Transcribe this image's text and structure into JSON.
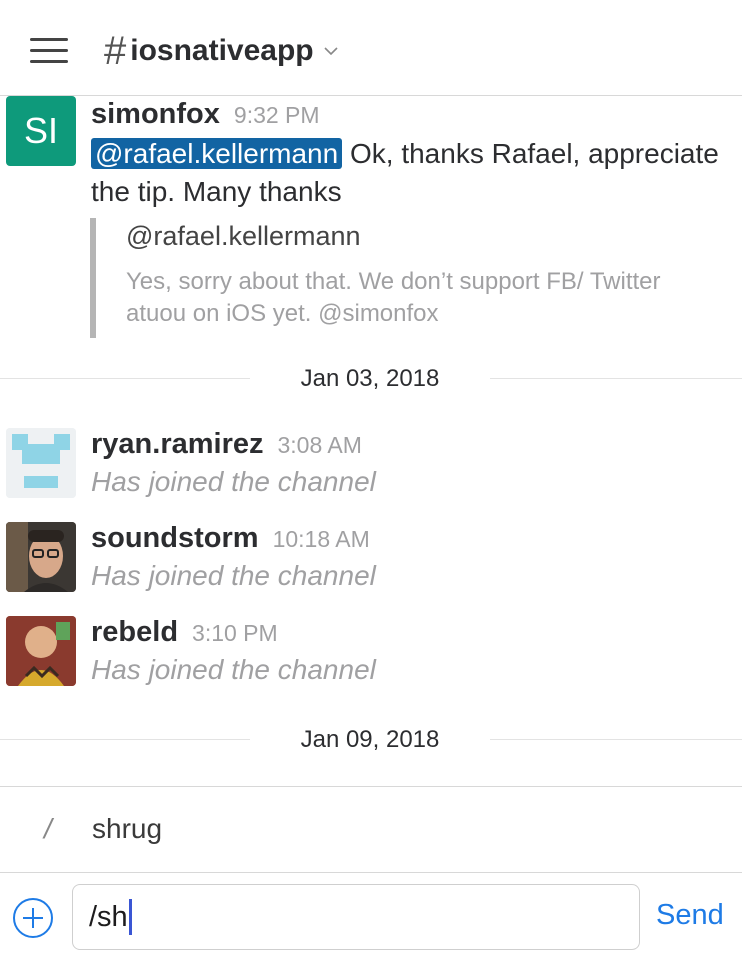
{
  "header": {
    "channel_hash": "#",
    "channel_name": "iosnativeapp"
  },
  "messages": [
    {
      "avatar_initials": "SI",
      "username": "simonfox",
      "time": "9:32 PM",
      "mention": "@rafael.kellermann",
      "text": " Ok, thanks Rafael, appreciate the tip. Many thanks",
      "quote": {
        "author": "@rafael.kellermann",
        "text": "Yes, sorry about that. We don’t support FB/ Twitter atuou on iOS yet. @simonfox"
      }
    },
    {
      "username": "ryan.ramirez",
      "time": "3:08 AM",
      "text": "Has joined the channel"
    },
    {
      "username": "soundstorm",
      "time": "10:18 AM",
      "text": "Has joined the channel"
    },
    {
      "username": "rebeld",
      "time": "3:10 PM",
      "text": "Has joined the channel"
    }
  ],
  "date_separators": [
    "Jan 03, 2018",
    "Jan 09, 2018"
  ],
  "suggestion": {
    "prefix": "/",
    "label": "shrug"
  },
  "composer": {
    "input_value": "/sh",
    "send_label": "Send"
  },
  "colors": {
    "accent": "#1e7be6",
    "mention_bg": "#1264a3",
    "avatar_si": "#0e9a7b"
  }
}
